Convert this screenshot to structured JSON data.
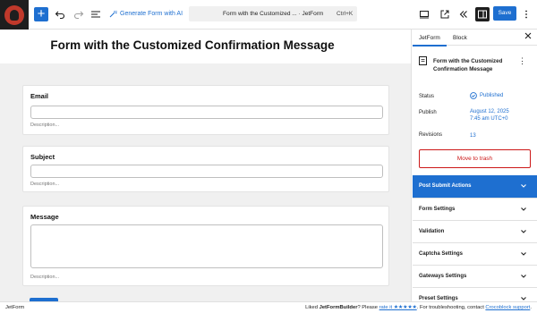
{
  "toolbar": {
    "generate_ai_label": "Generate Form with AI",
    "document_title": "Form with the Customized ... · JetForm",
    "shortcut": "Ctrl+K",
    "save_label": "Save"
  },
  "editor": {
    "page_title": "Form with the Customized Confirmation Message",
    "fields": [
      {
        "label": "Email",
        "description": "Description..."
      },
      {
        "label": "Subject",
        "description": "Description..."
      },
      {
        "label": "Message",
        "description": "Description..."
      }
    ]
  },
  "sidebar": {
    "tabs": [
      "JetForm",
      "Block"
    ],
    "post_title": "Form with the Customized Confirmation Message",
    "meta": {
      "status_label": "Status",
      "status_value": "Published",
      "publish_label": "Publish",
      "publish_date": "August 12, 2025",
      "publish_time": "7:45 am UTC+0",
      "revisions_label": "Revisions",
      "revisions_value": "13"
    },
    "trash_label": "Move to trash",
    "panels": [
      "Post Submit Actions",
      "Form Settings",
      "Validation",
      "Captcha Settings",
      "Gateways Settings",
      "Preset Settings"
    ]
  },
  "footer": {
    "left": "JetForm",
    "liked_prefix": "Liked ",
    "plugin_name": "JetFormBuilder",
    "please": "? Please ",
    "rate_link": "rate it ★★★★★",
    "troubleshoot": ". For troubleshooting, contact ",
    "support_link": "Crocoblock support",
    "period": "."
  },
  "colors": {
    "accent": "#1e6fd0",
    "danger": "#cc1818",
    "canvas_bg": "#f0f0f0"
  }
}
